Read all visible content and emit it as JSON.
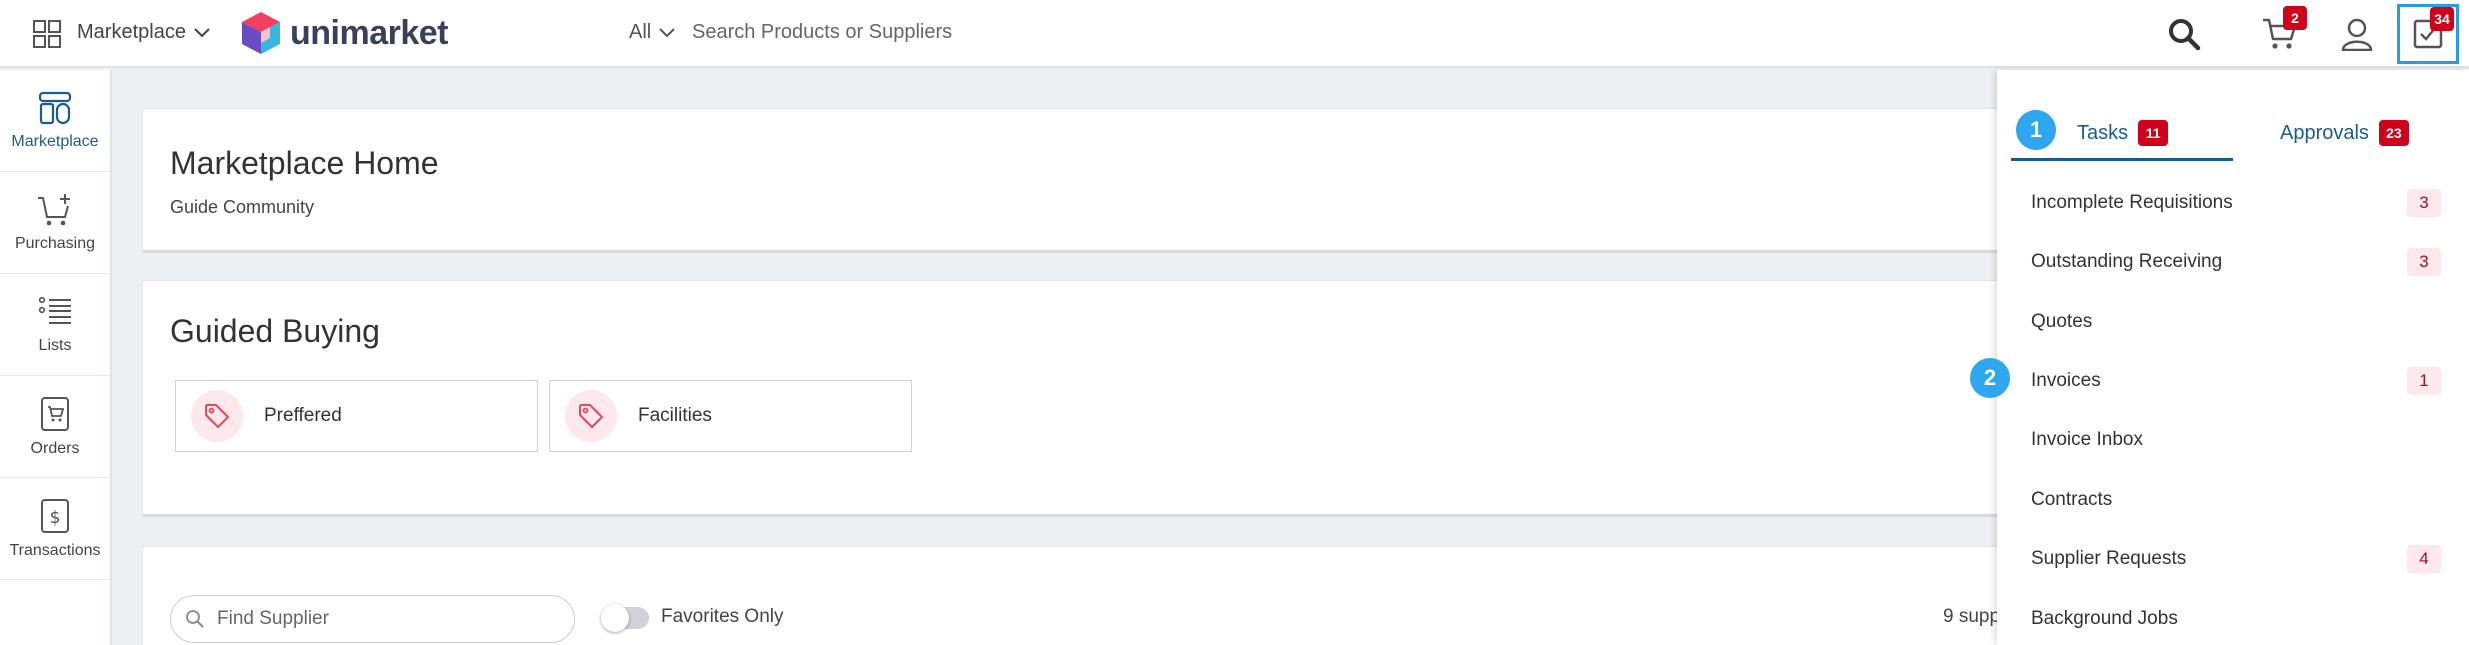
{
  "header": {
    "app_switcher_label": "Marketplace",
    "logo_text": "unimarket",
    "search_scope": "All",
    "search_placeholder": "Search Products or Suppliers",
    "cart_count": "2",
    "tasks_count": "34"
  },
  "sidebar": {
    "items": [
      {
        "label": "Marketplace",
        "icon": "storefront-icon"
      },
      {
        "label": "Purchasing",
        "icon": "cart-add-icon"
      },
      {
        "label": "Lists",
        "icon": "list-icon"
      },
      {
        "label": "Orders",
        "icon": "order-cart-icon"
      },
      {
        "label": "Transactions",
        "icon": "receipt-dollar-icon"
      }
    ]
  },
  "main": {
    "home_card": {
      "title": "Marketplace Home",
      "subtitle": "Guide Community"
    },
    "guided_buying": {
      "title": "Guided Buying",
      "tiles": [
        {
          "label": "Preffered",
          "icon": "tag-icon"
        },
        {
          "label": "Facilities",
          "icon": "tag-icon"
        }
      ]
    },
    "suppliers": {
      "search_placeholder": "Find Supplier",
      "favorites_label": "Favorites Only",
      "favorites_on": false,
      "count_text": "9 supp"
    }
  },
  "tasks_panel": {
    "tabs": [
      {
        "label": "Tasks",
        "count": "11",
        "active": true
      },
      {
        "label": "Approvals",
        "count": "23",
        "active": false
      }
    ],
    "items": [
      {
        "label": "Incomplete Requisitions",
        "count": "3"
      },
      {
        "label": "Outstanding Receiving",
        "count": "3"
      },
      {
        "label": "Quotes",
        "count": ""
      },
      {
        "label": "Invoices",
        "count": "1"
      },
      {
        "label": "Invoice Inbox",
        "count": ""
      },
      {
        "label": "Contracts",
        "count": ""
      },
      {
        "label": "Supplier Requests",
        "count": "4"
      },
      {
        "label": "Background Jobs",
        "count": ""
      }
    ]
  },
  "markers": [
    "1",
    "2"
  ],
  "colors": {
    "accent_blue": "#1b5d8a",
    "badge_red": "#d0021b",
    "marker_blue": "#2ea6f0",
    "tag_pink": "#e34a5f"
  }
}
